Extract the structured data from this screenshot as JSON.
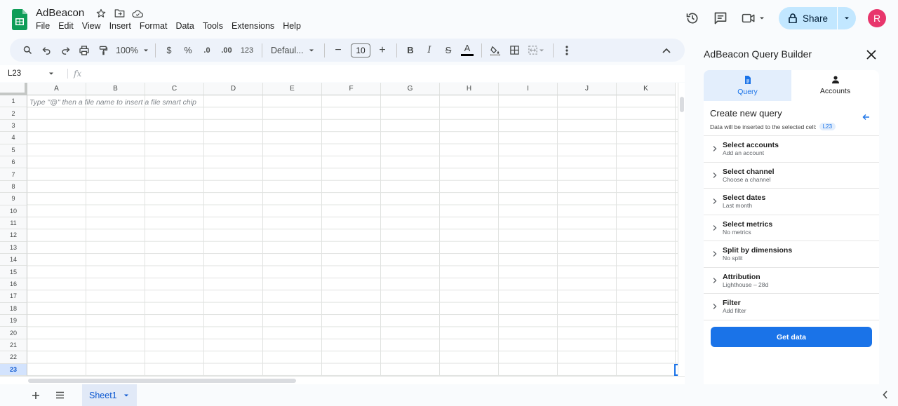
{
  "app": {
    "doc_title": "AdBeacon",
    "menu": [
      "File",
      "Edit",
      "View",
      "Insert",
      "Format",
      "Data",
      "Tools",
      "Extensions",
      "Help"
    ],
    "share_label": "Share",
    "avatar_letter": "R"
  },
  "toolbar": {
    "zoom": "100%",
    "currency": "$",
    "percent": "%",
    "dec_decrease": ".0",
    "dec_increase": ".00",
    "number_format": "123",
    "font": "Defaul...",
    "font_size": "10",
    "minus": "−",
    "plus": "+",
    "bold": "B",
    "italic": "I",
    "strike": "S",
    "text_color": "A"
  },
  "formula_bar": {
    "name_box": "L23",
    "fx": "fx"
  },
  "sheet": {
    "columns": [
      "A",
      "B",
      "C",
      "D",
      "E",
      "F",
      "G",
      "H",
      "I",
      "J",
      "K"
    ],
    "rows": [
      "1",
      "2",
      "3",
      "4",
      "5",
      "6",
      "7",
      "8",
      "9",
      "10",
      "11",
      "12",
      "13",
      "14",
      "15",
      "16",
      "17",
      "18",
      "19",
      "20",
      "21",
      "22",
      "23"
    ],
    "selected_row": "23",
    "cell_hint": "Type \"@\" then a file name to insert a file smart chip"
  },
  "tabs": {
    "sheet_name": "Sheet1"
  },
  "panel": {
    "title": "AdBeacon Query Builder",
    "tab_query": "Query",
    "tab_accounts": "Accounts",
    "heading": "Create new query",
    "subtext": "Data will be inserted to the selected cell:",
    "cell": "L23",
    "items": [
      {
        "label": "Select accounts",
        "value": "Add an account"
      },
      {
        "label": "Select channel",
        "value": "Choose a channel"
      },
      {
        "label": "Select dates",
        "value": "Last month"
      },
      {
        "label": "Select metrics",
        "value": "No metrics"
      },
      {
        "label": "Split by dimensions",
        "value": "No split"
      },
      {
        "label": "Attribution",
        "value": "Lighthouse – 28d"
      },
      {
        "label": "Filter",
        "value": "Add filter"
      }
    ],
    "button": "Get data"
  },
  "colors": {
    "accent": "#1a73e8",
    "share_bg": "#c2e7ff",
    "avatar": "#e8366c",
    "sheets_green": "#0f9d58"
  }
}
